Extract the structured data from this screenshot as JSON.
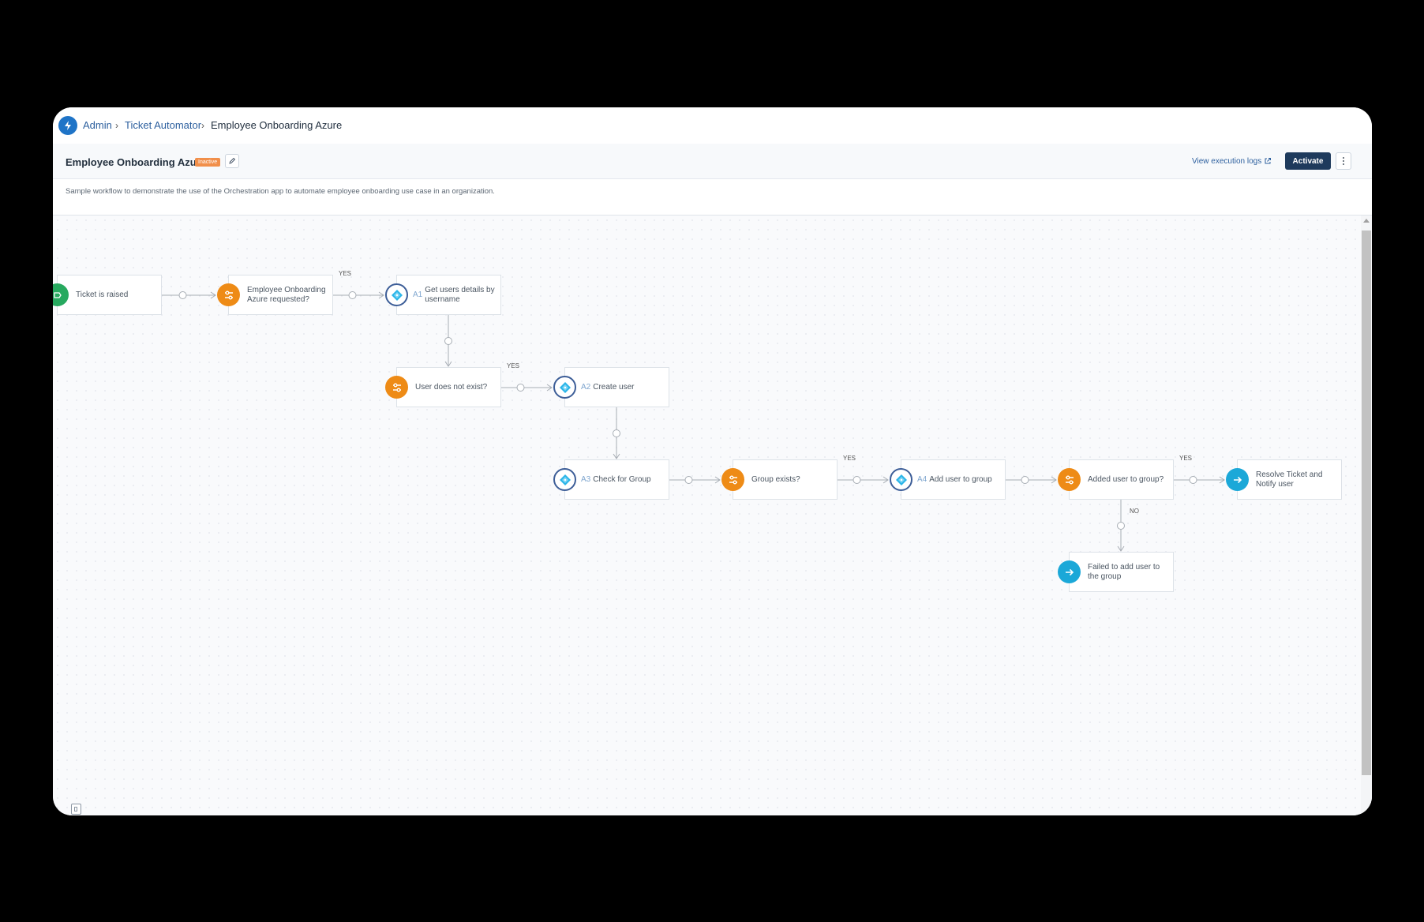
{
  "breadcrumb": {
    "items": [
      "Admin",
      "Ticket Automator",
      "Employee Onboarding Azure"
    ]
  },
  "header": {
    "title": "Employee Onboarding Azure",
    "status": "Inactive",
    "view_logs_label": "View execution logs",
    "activate_label": "Activate"
  },
  "description": "Sample workflow to demonstrate the use of the Orchestration app to automate employee onboarding use case in an organization.",
  "workflow": {
    "nodes": [
      {
        "id": "trigger",
        "type": "trigger",
        "prefix": "",
        "label": "Ticket is raised"
      },
      {
        "id": "cond1",
        "type": "condition",
        "prefix": "",
        "label": "Employee Onboarding Azure requested?"
      },
      {
        "id": "a1",
        "type": "action",
        "prefix": "A1",
        "label": "Get users details by username"
      },
      {
        "id": "cond2",
        "type": "condition",
        "prefix": "",
        "label": "User does not exist?"
      },
      {
        "id": "a2",
        "type": "action",
        "prefix": "A2",
        "label": "Create user"
      },
      {
        "id": "a3",
        "type": "action",
        "prefix": "A3",
        "label": "Check for Group"
      },
      {
        "id": "cond3",
        "type": "condition",
        "prefix": "",
        "label": "Group exists?"
      },
      {
        "id": "a4",
        "type": "action",
        "prefix": "A4",
        "label": "Add user to group"
      },
      {
        "id": "cond4",
        "type": "condition",
        "prefix": "",
        "label": "Added user to group?"
      },
      {
        "id": "end_ok",
        "type": "end",
        "prefix": "",
        "label": "Resolve Ticket and Notify user"
      },
      {
        "id": "end_fail",
        "type": "end",
        "prefix": "",
        "label": "Failed to add user to the group"
      }
    ],
    "edges": [
      {
        "from": "trigger",
        "to": "cond1",
        "label": ""
      },
      {
        "from": "cond1",
        "to": "a1",
        "label": "YES"
      },
      {
        "from": "a1",
        "to": "cond2",
        "label": ""
      },
      {
        "from": "cond2",
        "to": "a2",
        "label": "YES"
      },
      {
        "from": "a2",
        "to": "a3",
        "label": ""
      },
      {
        "from": "a3",
        "to": "cond3",
        "label": ""
      },
      {
        "from": "cond3",
        "to": "a4",
        "label": "YES"
      },
      {
        "from": "a4",
        "to": "cond4",
        "label": ""
      },
      {
        "from": "cond4",
        "to": "end_ok",
        "label": "YES"
      },
      {
        "from": "cond4",
        "to": "end_fail",
        "label": "NO"
      }
    ]
  },
  "colors": {
    "trigger": "#27a95f",
    "condition": "#ee8b16",
    "action_border": "#3d5e98",
    "action_diamond": "#2bb5e8",
    "end": "#1ba8d8",
    "activate_bg": "#1e3a5c",
    "status_badge": "#f18f4a"
  },
  "icons": {
    "app_logo": "lightning-bolt-icon",
    "edit": "pencil-icon",
    "external_link": "external-link-icon",
    "more": "vertical-ellipsis-icon",
    "trigger": "trigger-icon",
    "condition": "condition-sliders-icon",
    "action": "azure-ad-icon",
    "end": "arrow-right-icon",
    "minimap": "minimap-toggle-icon"
  }
}
